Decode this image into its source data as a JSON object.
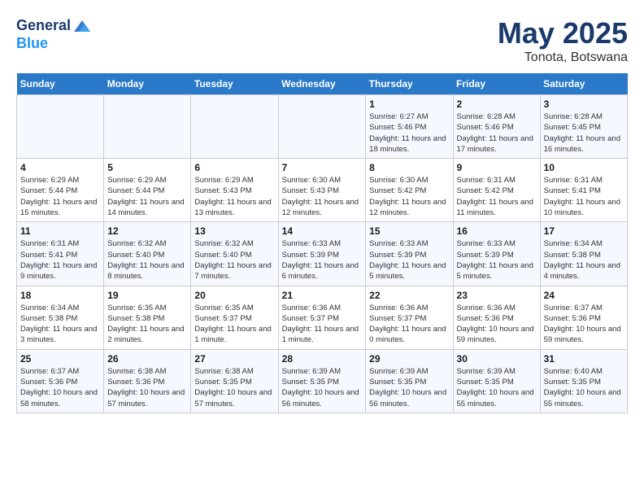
{
  "header": {
    "logo_line1": "General",
    "logo_line2": "Blue",
    "title": "May 2025",
    "subtitle": "Tonota, Botswana"
  },
  "days_of_week": [
    "Sunday",
    "Monday",
    "Tuesday",
    "Wednesday",
    "Thursday",
    "Friday",
    "Saturday"
  ],
  "weeks": [
    [
      {
        "day": "",
        "info": ""
      },
      {
        "day": "",
        "info": ""
      },
      {
        "day": "",
        "info": ""
      },
      {
        "day": "",
        "info": ""
      },
      {
        "day": "1",
        "info": "Sunrise: 6:27 AM\nSunset: 5:46 PM\nDaylight: 11 hours and 18 minutes."
      },
      {
        "day": "2",
        "info": "Sunrise: 6:28 AM\nSunset: 5:46 PM\nDaylight: 11 hours and 17 minutes."
      },
      {
        "day": "3",
        "info": "Sunrise: 6:28 AM\nSunset: 5:45 PM\nDaylight: 11 hours and 16 minutes."
      }
    ],
    [
      {
        "day": "4",
        "info": "Sunrise: 6:29 AM\nSunset: 5:44 PM\nDaylight: 11 hours and 15 minutes."
      },
      {
        "day": "5",
        "info": "Sunrise: 6:29 AM\nSunset: 5:44 PM\nDaylight: 11 hours and 14 minutes."
      },
      {
        "day": "6",
        "info": "Sunrise: 6:29 AM\nSunset: 5:43 PM\nDaylight: 11 hours and 13 minutes."
      },
      {
        "day": "7",
        "info": "Sunrise: 6:30 AM\nSunset: 5:43 PM\nDaylight: 11 hours and 12 minutes."
      },
      {
        "day": "8",
        "info": "Sunrise: 6:30 AM\nSunset: 5:42 PM\nDaylight: 11 hours and 12 minutes."
      },
      {
        "day": "9",
        "info": "Sunrise: 6:31 AM\nSunset: 5:42 PM\nDaylight: 11 hours and 11 minutes."
      },
      {
        "day": "10",
        "info": "Sunrise: 6:31 AM\nSunset: 5:41 PM\nDaylight: 11 hours and 10 minutes."
      }
    ],
    [
      {
        "day": "11",
        "info": "Sunrise: 6:31 AM\nSunset: 5:41 PM\nDaylight: 11 hours and 9 minutes."
      },
      {
        "day": "12",
        "info": "Sunrise: 6:32 AM\nSunset: 5:40 PM\nDaylight: 11 hours and 8 minutes."
      },
      {
        "day": "13",
        "info": "Sunrise: 6:32 AM\nSunset: 5:40 PM\nDaylight: 11 hours and 7 minutes."
      },
      {
        "day": "14",
        "info": "Sunrise: 6:33 AM\nSunset: 5:39 PM\nDaylight: 11 hours and 6 minutes."
      },
      {
        "day": "15",
        "info": "Sunrise: 6:33 AM\nSunset: 5:39 PM\nDaylight: 11 hours and 5 minutes."
      },
      {
        "day": "16",
        "info": "Sunrise: 6:33 AM\nSunset: 5:39 PM\nDaylight: 11 hours and 5 minutes."
      },
      {
        "day": "17",
        "info": "Sunrise: 6:34 AM\nSunset: 5:38 PM\nDaylight: 11 hours and 4 minutes."
      }
    ],
    [
      {
        "day": "18",
        "info": "Sunrise: 6:34 AM\nSunset: 5:38 PM\nDaylight: 11 hours and 3 minutes."
      },
      {
        "day": "19",
        "info": "Sunrise: 6:35 AM\nSunset: 5:38 PM\nDaylight: 11 hours and 2 minutes."
      },
      {
        "day": "20",
        "info": "Sunrise: 6:35 AM\nSunset: 5:37 PM\nDaylight: 11 hours and 1 minute."
      },
      {
        "day": "21",
        "info": "Sunrise: 6:36 AM\nSunset: 5:37 PM\nDaylight: 11 hours and 1 minute."
      },
      {
        "day": "22",
        "info": "Sunrise: 6:36 AM\nSunset: 5:37 PM\nDaylight: 11 hours and 0 minutes."
      },
      {
        "day": "23",
        "info": "Sunrise: 6:36 AM\nSunset: 5:36 PM\nDaylight: 10 hours and 59 minutes."
      },
      {
        "day": "24",
        "info": "Sunrise: 6:37 AM\nSunset: 5:36 PM\nDaylight: 10 hours and 59 minutes."
      }
    ],
    [
      {
        "day": "25",
        "info": "Sunrise: 6:37 AM\nSunset: 5:36 PM\nDaylight: 10 hours and 58 minutes."
      },
      {
        "day": "26",
        "info": "Sunrise: 6:38 AM\nSunset: 5:36 PM\nDaylight: 10 hours and 57 minutes."
      },
      {
        "day": "27",
        "info": "Sunrise: 6:38 AM\nSunset: 5:35 PM\nDaylight: 10 hours and 57 minutes."
      },
      {
        "day": "28",
        "info": "Sunrise: 6:39 AM\nSunset: 5:35 PM\nDaylight: 10 hours and 56 minutes."
      },
      {
        "day": "29",
        "info": "Sunrise: 6:39 AM\nSunset: 5:35 PM\nDaylight: 10 hours and 56 minutes."
      },
      {
        "day": "30",
        "info": "Sunrise: 6:39 AM\nSunset: 5:35 PM\nDaylight: 10 hours and 55 minutes."
      },
      {
        "day": "31",
        "info": "Sunrise: 6:40 AM\nSunset: 5:35 PM\nDaylight: 10 hours and 55 minutes."
      }
    ]
  ]
}
